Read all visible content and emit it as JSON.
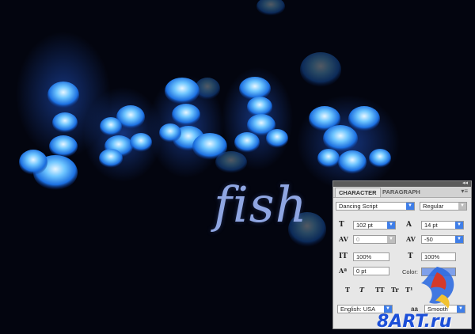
{
  "canvas": {
    "headline_text": "fish"
  },
  "panel": {
    "tabs": [
      {
        "label": "CHARACTER",
        "active": true
      },
      {
        "label": "PARAGRAPH",
        "active": false
      }
    ],
    "menu_icon": "panel-menu-icon",
    "font_family": "Dancing Script",
    "font_style": "Regular",
    "font_size": "102 pt",
    "leading": "14 pt",
    "kerning": "0",
    "tracking": "-50",
    "vertical_scale": "100%",
    "horizontal_scale": "100%",
    "baseline_shift": "0 pt",
    "color_label": "Color:",
    "color_value": "#7fa0ea",
    "style_buttons": [
      "T",
      "T",
      "TT",
      "Tr",
      "T¹"
    ],
    "language": "English: USA",
    "antialias": "Smooth",
    "aa_icon_text": "aa"
  },
  "watermark": "8ART.ru"
}
